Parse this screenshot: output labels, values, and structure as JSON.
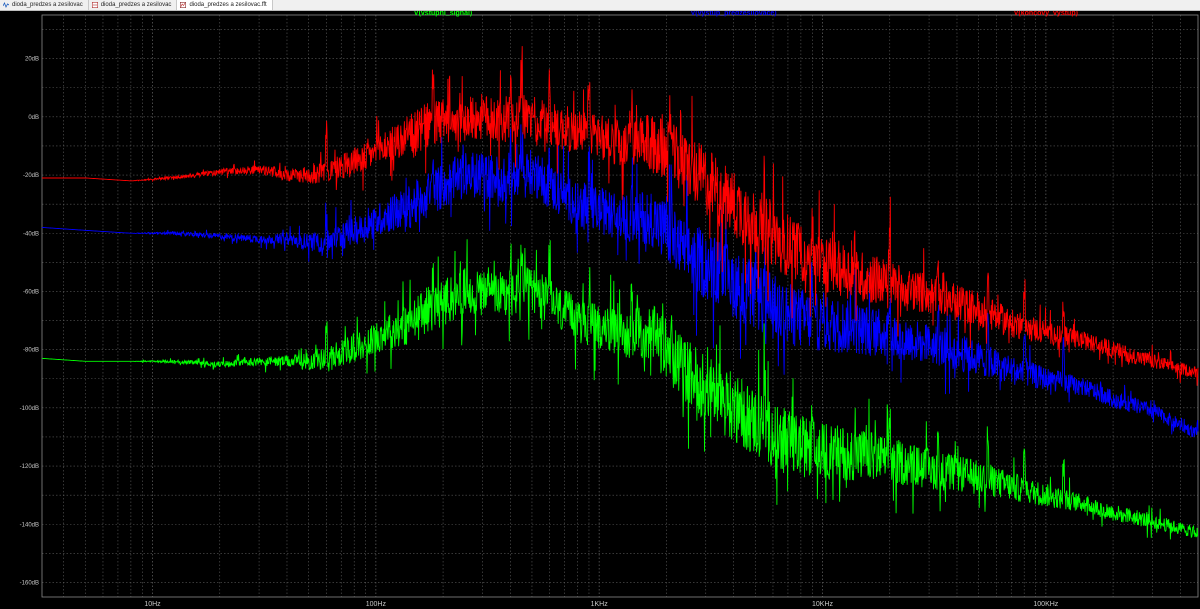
{
  "tabs": [
    {
      "label": "dioda_predzes a zesilovac",
      "icon": "waveform-icon",
      "active": false
    },
    {
      "label": "dioda_predzes a zesilovac",
      "icon": "schematic-icon",
      "active": false
    },
    {
      "label": "dioda_predzes a zesilovac.fft",
      "icon": "fft-plot-icon",
      "active": true
    }
  ],
  "colors": {
    "background": "#000000",
    "grid": "#5a5a5a",
    "axis_text": "#c8c8c8",
    "series": [
      "#00ff00",
      "#0000ff",
      "#ff0000"
    ]
  },
  "chart_data": {
    "type": "line",
    "x_scale": "log",
    "x_unit": "Hz",
    "xlim": [
      3.2,
      480000
    ],
    "ylim": [
      -165,
      35
    ],
    "grid": true,
    "legend_placement": "top",
    "x_ticks": [
      {
        "value": 10,
        "label": "10Hz"
      },
      {
        "value": 100,
        "label": "100Hz"
      },
      {
        "value": 1000,
        "label": "1KHz"
      },
      {
        "value": 10000,
        "label": "10KHz"
      },
      {
        "value": 100000,
        "label": "100KHz"
      }
    ],
    "y_ticks": [
      {
        "value": 20,
        "label": "20dB"
      },
      {
        "value": 0,
        "label": "0dB"
      },
      {
        "value": -20,
        "label": "-20dB"
      },
      {
        "value": -40,
        "label": "-40dB"
      },
      {
        "value": -60,
        "label": "-60dB"
      },
      {
        "value": -80,
        "label": "-80dB"
      },
      {
        "value": -100,
        "label": "-100dB"
      },
      {
        "value": -120,
        "label": "-120dB"
      },
      {
        "value": -140,
        "label": "-140dB"
      },
      {
        "value": -160,
        "label": "-160dB"
      }
    ],
    "series": [
      {
        "name": "V(vstupni_signal)",
        "color": "#00ff00",
        "x": [
          3.2,
          5,
          8,
          12,
          20,
          30,
          40,
          50,
          60,
          75,
          90,
          110,
          130,
          150,
          170,
          200,
          250,
          300,
          400,
          500,
          600,
          800,
          1000,
          1300,
          1700,
          2000,
          2300,
          3000,
          4000,
          5000,
          7000,
          10000,
          15000,
          20000,
          30000,
          50000,
          70000,
          100000,
          150000,
          200000,
          300000,
          480000
        ],
        "y": [
          -83,
          -84,
          -84,
          -84,
          -85,
          -84,
          -84,
          -84,
          -83,
          -80,
          -78,
          -74,
          -72,
          -70,
          -66,
          -64,
          -60,
          -60,
          -62,
          -59,
          -64,
          -70,
          -72,
          -75,
          -74,
          -80,
          -85,
          -93,
          -100,
          -105,
          -112,
          -115,
          -116,
          -118,
          -121,
          -124,
          -127,
          -130,
          -133,
          -136,
          -139,
          -143
        ],
        "noise": [
          0,
          0,
          0,
          0.5,
          1,
          1.5,
          2,
          3,
          4,
          5,
          5,
          6,
          7,
          8,
          8,
          8,
          8,
          8,
          8,
          8,
          8,
          8,
          8,
          8,
          10,
          11,
          11,
          12,
          12,
          12,
          11,
          10,
          9,
          8,
          7,
          6,
          5,
          4,
          3,
          3,
          2.5,
          2
        ]
      },
      {
        "name": "V(vystup_predzesilovace)",
        "color": "#0000ff",
        "x": [
          3.2,
          5,
          8,
          12,
          20,
          30,
          40,
          50,
          60,
          75,
          90,
          110,
          130,
          150,
          170,
          200,
          250,
          300,
          400,
          500,
          600,
          800,
          1000,
          1300,
          1700,
          2000,
          2300,
          3000,
          4000,
          5000,
          7000,
          10000,
          15000,
          20000,
          30000,
          50000,
          70000,
          100000,
          150000,
          200000,
          300000,
          480000
        ],
        "y": [
          -38,
          -39,
          -40,
          -40,
          -41,
          -42,
          -42,
          -43,
          -43,
          -40,
          -38,
          -34,
          -32,
          -30,
          -26,
          -24,
          -20,
          -20,
          -22,
          -19,
          -24,
          -30,
          -32,
          -35,
          -34,
          -40,
          -45,
          -51,
          -57,
          -62,
          -68,
          -71,
          -73,
          -75,
          -78,
          -83,
          -87,
          -90,
          -93,
          -97,
          -101,
          -109
        ],
        "noise": [
          0,
          0,
          0,
          0.5,
          1,
          1.5,
          2,
          3,
          4,
          5,
          5,
          6,
          7,
          8,
          8,
          8,
          8,
          8,
          8,
          8,
          8,
          8,
          8,
          8,
          10,
          11,
          11,
          12,
          12,
          12,
          11,
          10,
          9,
          8,
          7,
          6,
          5,
          4,
          3,
          3,
          2.5,
          2
        ]
      },
      {
        "name": "V(koncovy_vystup)",
        "color": "#ff0000",
        "x": [
          3.2,
          5,
          8,
          12,
          20,
          30,
          40,
          50,
          60,
          75,
          90,
          110,
          130,
          150,
          170,
          200,
          250,
          300,
          400,
          500,
          600,
          800,
          1000,
          1300,
          1700,
          2000,
          2300,
          3000,
          4000,
          5000,
          7000,
          10000,
          15000,
          20000,
          30000,
          50000,
          70000,
          100000,
          150000,
          200000,
          300000,
          480000
        ],
        "y": [
          -21,
          -21,
          -22,
          -21,
          -19,
          -18,
          -20,
          -20,
          -19,
          -16,
          -14,
          -10,
          -8,
          -6,
          -3,
          -2,
          -1,
          0,
          -1,
          0,
          -3,
          -5,
          -6,
          -10,
          -9,
          -12,
          -15,
          -22,
          -30,
          -36,
          -44,
          -50,
          -55,
          -57,
          -61,
          -66,
          -71,
          -74,
          -77,
          -80,
          -84,
          -88
        ],
        "noise": [
          0,
          0,
          0,
          0.5,
          1,
          1.5,
          2,
          3,
          4,
          5,
          5,
          6,
          7,
          8,
          8,
          8,
          8,
          8,
          8,
          8,
          8,
          8,
          8,
          8,
          10,
          11,
          11,
          12,
          12,
          12,
          11,
          10,
          9,
          8,
          7,
          6,
          5,
          4,
          3,
          3,
          2.5,
          2
        ]
      }
    ]
  }
}
